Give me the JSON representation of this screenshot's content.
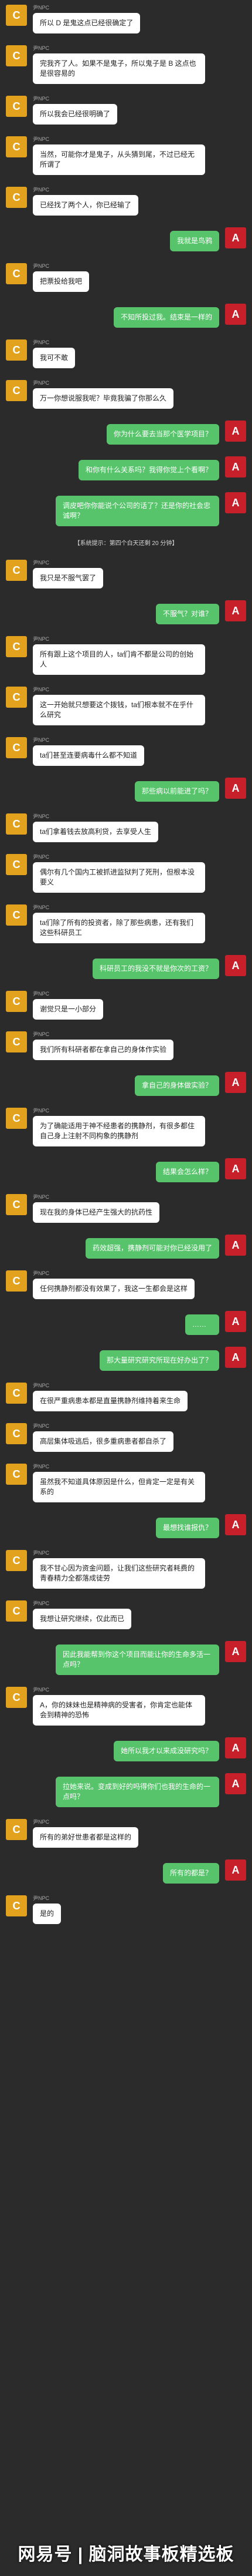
{
  "npc_name": "尹NPC",
  "player_initial": "A",
  "npc_initial": "C",
  "messages": [
    {
      "side": "left",
      "text": "所以 D 是鬼这点已经很确定了"
    },
    {
      "side": "left",
      "text": "完我齐了人。如果不是鬼子，所以鬼子是 B 这点也是很容易的"
    },
    {
      "side": "left",
      "text": "所以我会已经很明确了"
    },
    {
      "side": "left",
      "text": "当然，可能你才是鬼子，从头猜到尾，不过已经无所谓了"
    },
    {
      "side": "left",
      "text": "已经找了两个人，你已经输了"
    },
    {
      "side": "right",
      "text": "我就是鸟鸦"
    },
    {
      "side": "left",
      "text": "把票投给我吧"
    },
    {
      "side": "right",
      "text": "不知所投过我。结束是一样的"
    },
    {
      "side": "left",
      "text": "我可不敢"
    },
    {
      "side": "left",
      "text": "万一你想说服我呢？毕竟我骗了你那么久"
    },
    {
      "side": "right",
      "text": "你为什么要去当那个医学项目？"
    },
    {
      "side": "right",
      "text": "和你有什么关系吗？我得你觉上个看啊？"
    },
    {
      "side": "right",
      "text": "调皮吧你你能说个公司的话了？还是你的社会忠诚啊？"
    },
    {
      "side": "system",
      "text": "【系统提示：第四个白天还剩 20 分钟】"
    },
    {
      "side": "left",
      "text": "我只是不服气罢了"
    },
    {
      "side": "right",
      "text": "不服气？对谁？"
    },
    {
      "side": "left",
      "text": "所有跟上这个项目的人，ta们肯不都是公司的创始人"
    },
    {
      "side": "left",
      "text": "这一开始就只想要这个拨钱，ta们根本就不在乎什么研究"
    },
    {
      "side": "left",
      "text": "ta们甚至连要病毒什么都不知道"
    },
    {
      "side": "right",
      "text": "那些病以前能进了吗？"
    },
    {
      "side": "left",
      "text": "ta们拿着钱去放高利贷，去享受人生"
    },
    {
      "side": "left",
      "text": "偶尔有几个国内工被抓进监狱判了死刑，但根本没要义"
    },
    {
      "side": "left",
      "text": "ta们除了所有的投资者，除了那些病患，还有我们这些科研员工"
    },
    {
      "side": "right",
      "text": "科研员工的我没不就是你次的工资？"
    },
    {
      "side": "left",
      "text": "谢觉只是一小部分"
    },
    {
      "side": "left",
      "text": "我们所有科研者都在拿自己的身体作实验"
    },
    {
      "side": "right",
      "text": "拿自己的身体做实验？"
    },
    {
      "side": "left",
      "text": "为了确能适用于神不经患者的携静剂，有很多都住自己身上注射不同构象的携静剂"
    },
    {
      "side": "right",
      "text": "结果会怎么样？"
    },
    {
      "side": "left",
      "text": "现在我的身体已经产生强大的抗药性"
    },
    {
      "side": "right",
      "text": "药效超强，携静剂可能对你已经没用了"
    },
    {
      "side": "left",
      "text": "任何携静剂都没有效果了，我这一生都会是这样"
    },
    {
      "side": "right",
      "text": "……"
    },
    {
      "side": "right",
      "text": "那大量研究研究所现在好办出了？"
    },
    {
      "side": "left",
      "text": "在很严重病患本都是直量携静剂维持着来生命"
    },
    {
      "side": "left",
      "text": "高层集体吸逃后，很多重病患者都自杀了"
    },
    {
      "side": "left",
      "text": "虽然我不知道具体原因是什么，但肯定一定是有关系的"
    },
    {
      "side": "right",
      "text": "最想找谁报仇？"
    },
    {
      "side": "left",
      "text": "我不甘心因为资金问题，让我们这些研究者耗费的青春精力全都落成徒劳"
    },
    {
      "side": "left",
      "text": "我想让研究继续，仅此而已"
    },
    {
      "side": "right",
      "text": "因此我能帮到你这个项目而能让你的生命多活一点吗？"
    },
    {
      "side": "left",
      "text": "A，你的妹妹也是精神病的受害者，你肯定也能体会到精神的恐怖"
    },
    {
      "side": "right",
      "text": "她所以我才以来成没研究吗？"
    },
    {
      "side": "right",
      "text": "拉她来说。变成到好的吗得你们也我的生命的一点吗？"
    },
    {
      "side": "left",
      "text": "所有的弟好世患者都是这样的"
    },
    {
      "side": "right",
      "text": "所有的都是？"
    },
    {
      "side": "left",
      "text": "是的"
    }
  ],
  "watermark_text": "网易号 | 脑洞故事板精选板"
}
